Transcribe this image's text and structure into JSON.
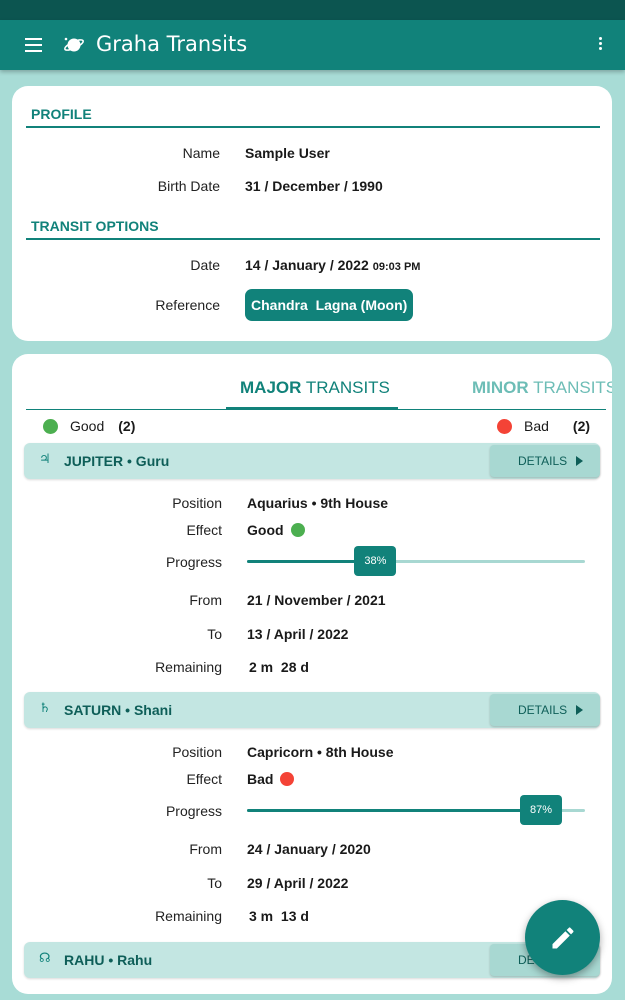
{
  "app": {
    "title": "Graha Transits"
  },
  "profile": {
    "heading": "PROFILE",
    "name_label": "Name",
    "name_value": "Sample User",
    "birth_label": "Birth Date",
    "birth_value": "31 / December / 1990"
  },
  "transit_options": {
    "heading": "TRANSIT OPTIONS",
    "date_label": "Date",
    "date_value": "14 / January / 2022",
    "time_value": "09:03 PM",
    "reference_label": "Reference",
    "reference_value": "Chandra  Lagna (Moon)"
  },
  "tabs": {
    "major_a": "MAJOR",
    "major_b": " TRANSITS",
    "minor_a": "MINOR",
    "minor_b": " TRANSITS"
  },
  "legend": {
    "good_label": "Good",
    "good_count": "(2)",
    "bad_label": "Bad",
    "bad_count": "(2)"
  },
  "details_label": "DETAILS",
  "labels": {
    "position": "Position",
    "effect": "Effect",
    "progress": "Progress",
    "from": "From",
    "to": "To",
    "remaining": "Remaining"
  },
  "planets": [
    {
      "symbol": "♃",
      "name": "JUPITER • Guru",
      "position": "Aquarius • 9th House",
      "effect": "Good",
      "effect_color": "#4caf50",
      "progress": 0.38,
      "progress_label": "38%",
      "from": "21 / November / 2021",
      "to": "13 / April / 2022",
      "remaining": "2 m  28 d"
    },
    {
      "symbol": "♄",
      "name": "SATURN • Shani",
      "position": "Capricorn • 8th House",
      "effect": "Bad",
      "effect_color": "#f44336",
      "progress": 0.87,
      "progress_label": "87%",
      "from": "24 / January / 2020",
      "to": "29 / April / 2022",
      "remaining": "3 m  13 d"
    },
    {
      "symbol": "☊",
      "name": "RAHU • Rahu"
    }
  ],
  "colors": {
    "primary": "#11827a",
    "background": "#a8dcd6",
    "good": "#4caf50",
    "bad": "#f44336"
  }
}
